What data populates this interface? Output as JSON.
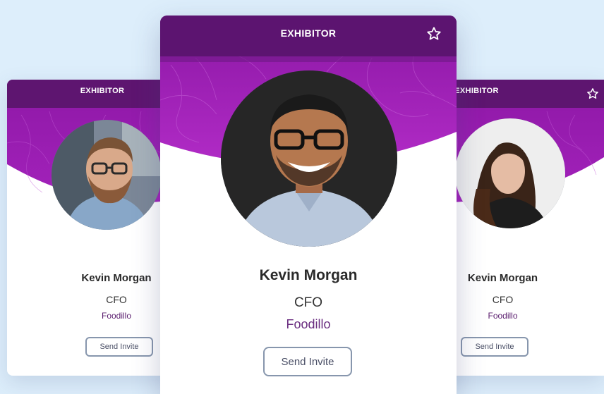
{
  "theme": {
    "banner_top": "#5e1570",
    "banner_main": "#8f1aa8",
    "banner_light": "#b12bc6",
    "company_color": "#5a1d6e",
    "button_border": "#8796ad",
    "background": "#ddeefb"
  },
  "cards": {
    "left": {
      "header": "EXHIBITOR",
      "name": "Kevin Morgan",
      "role": "CFO",
      "company": "Foodillo",
      "invite_label": "Send Invite",
      "avatar": "bearded-man-glasses-photo"
    },
    "center": {
      "header": "EXHIBITOR",
      "star_icon": "star-outline-icon",
      "name": "Kevin Morgan",
      "role": "CFO",
      "company": "Foodillo",
      "invite_label": "Send Invite",
      "avatar": "smiling-man-glasses-photo"
    },
    "right": {
      "header": "EXHIBITOR",
      "star_icon": "star-outline-icon",
      "name": "Kevin Morgan",
      "role": "CFO",
      "company": "Foodillo",
      "invite_label": "Send Invite",
      "avatar": "woman-long-hair-photo"
    }
  }
}
